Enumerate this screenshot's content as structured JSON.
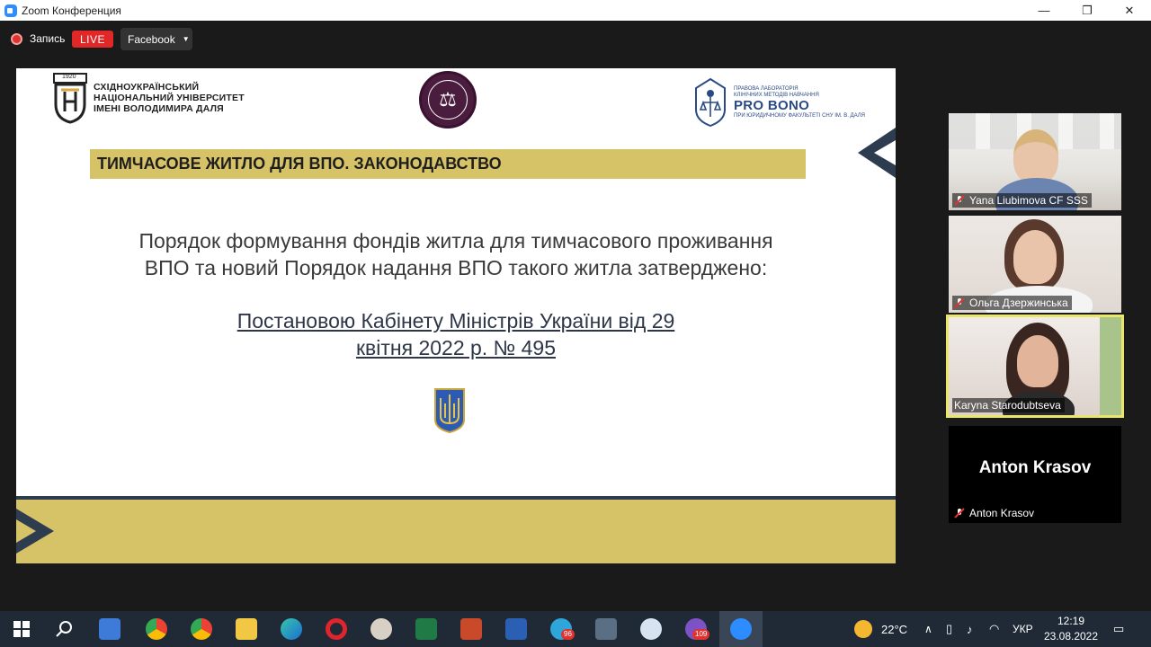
{
  "window": {
    "title": "Zoom Конференция",
    "minimize": "—",
    "restore": "❐",
    "close": "✕"
  },
  "topbar": {
    "record_label": "Запись",
    "live_label": "LIVE",
    "stream_target": "Facebook"
  },
  "slide": {
    "university_lines": [
      "СХІДНОУКРАЇНСЬКИЙ",
      "НАЦІОНАЛЬНИЙ УНІВЕРСИТЕТ",
      "ІМЕНІ ВОЛОДИМИРА ДАЛЯ"
    ],
    "university_year": "1920",
    "seal_symbol": "⚖",
    "probono_small": [
      "Правова лабораторія",
      "клінічних методів навчання"
    ],
    "probono_big": "PRO BONO",
    "probono_sub": "при юридичному факультеті СНУ ім. В. Даля",
    "banner": "ТИМЧАСОВЕ ЖИТЛО ДЛЯ ВПО. ЗАКОНОДАВСТВО",
    "paragraph_lines": [
      "Порядок формування фондів житла для тимчасового проживання",
      "ВПО та новий Порядок надання ВПО такого житла затверджено:"
    ],
    "link_lines": [
      "Постановою Кабінету Міністрів України від 29",
      "квітня 2022 р. № 495"
    ]
  },
  "participants": [
    {
      "name": "Yana Liubimova CF SSS",
      "muted": true
    },
    {
      "name": "Ольга Дзержинська",
      "muted": true
    },
    {
      "name": "Karyna Starodubtseva",
      "muted": false,
      "active_speaker": true
    },
    {
      "name": "Anton Krasov",
      "muted": true,
      "video_off": true
    }
  ],
  "taskbar": {
    "apps": [
      "start-icon",
      "search-icon",
      "store-icon",
      "chrome-icon",
      "chrome-profile-icon",
      "file-explorer-icon",
      "edge-icon",
      "opera-icon",
      "paint-icon",
      "excel-icon",
      "powerpoint-icon",
      "word-icon",
      "telegram-icon",
      "calculator-icon",
      "cloud-app-icon",
      "viber-icon",
      "zoom-icon"
    ],
    "telegram_badge": "96",
    "viber_badge": "109",
    "weather": "22°C",
    "language": "УКР",
    "time": "12:19",
    "date": "23.08.2022"
  },
  "colors": {
    "accent_gold": "#d6c267",
    "slide_navy": "#2e3c4f",
    "live_red": "#e02828",
    "speaker_highlight": "#e9e66b",
    "taskbar_bg": "#1f2a36"
  }
}
